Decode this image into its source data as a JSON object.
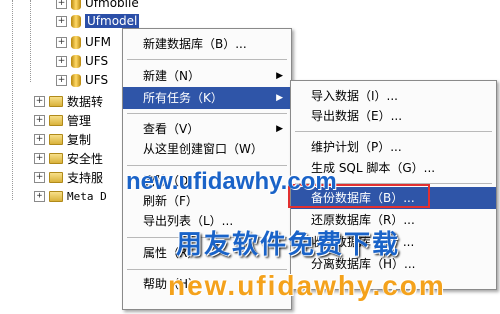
{
  "tree": {
    "items": [
      {
        "label": "Ufmobile"
      },
      {
        "label": "Ufmodel"
      },
      {
        "label": "UFM"
      },
      {
        "label": "UFS"
      },
      {
        "label": "UFS"
      },
      {
        "label": "数据转"
      },
      {
        "label": "管理"
      },
      {
        "label": "复制"
      },
      {
        "label": "安全性"
      },
      {
        "label": "支持服"
      },
      {
        "label": "Meta D"
      }
    ]
  },
  "context_menu": {
    "items": [
      {
        "label": "新建数据库（B）..."
      },
      {
        "label": "新建（N）"
      },
      {
        "label": "所有任务（K）"
      },
      {
        "label": "查看（V）"
      },
      {
        "label": "从这里创建窗口（W）"
      },
      {
        "label": "删除（D）"
      },
      {
        "label": "刷新（F）"
      },
      {
        "label": "导出列表（L）..."
      },
      {
        "label": "属性（R）"
      },
      {
        "label": "帮助（H）"
      }
    ]
  },
  "submenu": {
    "items": [
      {
        "label": "导入数据（I）..."
      },
      {
        "label": "导出数据（E）..."
      },
      {
        "label": "维护计划（P）..."
      },
      {
        "label": "生成 SQL 脚本（G）..."
      },
      {
        "label": "备份数据库（B）..."
      },
      {
        "label": "还原数据库（R）..."
      },
      {
        "label": "收缩数据库（K）..."
      },
      {
        "label": "分离数据库（H）..."
      }
    ]
  },
  "watermark": {
    "url_top": "new.ufidawhy.com",
    "slogan": "用友软件免费下载",
    "url_bottom": "new.ufidawhy.com"
  },
  "colors": {
    "highlight": "#2f55a8",
    "red_box": "#e23030",
    "wm_blue": "#1a63c8",
    "wm_orange": "#f4a21c"
  }
}
